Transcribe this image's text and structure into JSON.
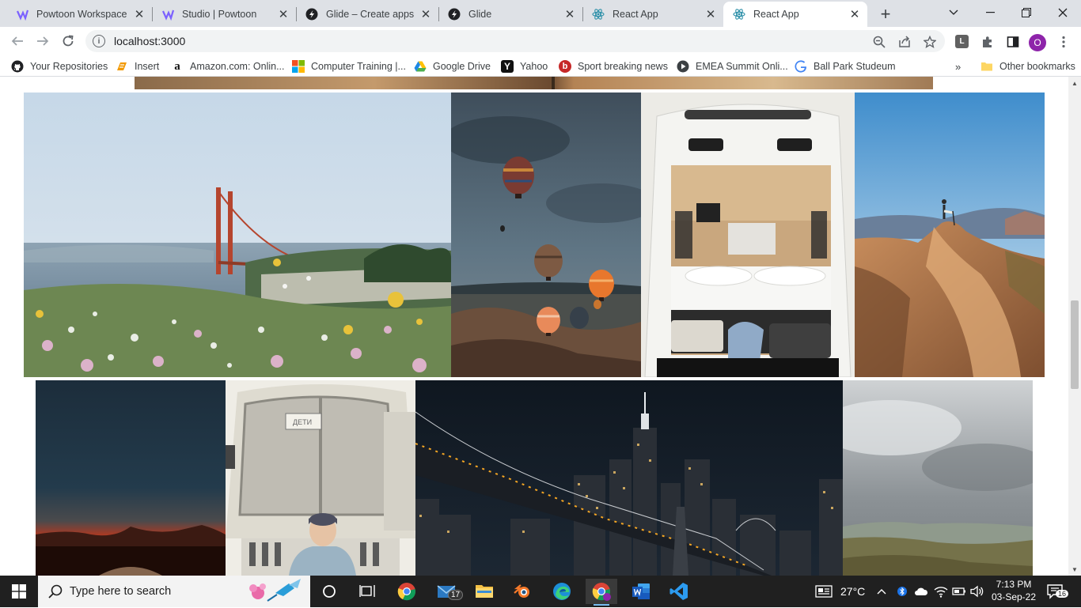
{
  "browser": {
    "tabs": [
      {
        "title": "Powtoon Workspace",
        "icon": "powtoon-icon",
        "active": false
      },
      {
        "title": "Studio | Powtoon",
        "icon": "powtoon-icon",
        "active": false
      },
      {
        "title": "Glide – Create apps &",
        "icon": "glide-icon",
        "active": false
      },
      {
        "title": "Glide",
        "icon": "glide-icon",
        "active": false
      },
      {
        "title": "React App",
        "icon": "react-icon",
        "active": false
      },
      {
        "title": "React App",
        "icon": "react-icon",
        "active": true
      }
    ],
    "url": "localhost:3000",
    "profile_initial": "O",
    "extension_initial": "L",
    "bookmarks": [
      {
        "label": "Your Repositories",
        "icon": "github-icon"
      },
      {
        "label": "Insert",
        "icon": "insert-icon"
      },
      {
        "label": "Amazon.com: Onlin...",
        "icon": "amazon-icon"
      },
      {
        "label": "Computer Training |...",
        "icon": "microsoft-icon"
      },
      {
        "label": "Google Drive",
        "icon": "google-drive-icon"
      },
      {
        "label": "Yahoo",
        "icon": "yahoo-icon"
      },
      {
        "label": "Sport breaking news",
        "icon": "sport-icon"
      },
      {
        "label": "EMEA Summit Onli...",
        "icon": "video-icon"
      },
      {
        "label": "Ball Park Studeum",
        "icon": "google-icon"
      }
    ],
    "other_bookmarks": "Other bookmarks"
  },
  "gallery": {
    "images": [
      {
        "subject": "golden-gate-bridge-flowers"
      },
      {
        "subject": "hot-air-balloons"
      },
      {
        "subject": "camper-van-interior"
      },
      {
        "subject": "hiker-desert-ridge"
      },
      {
        "subject": "sunset-dark-sky"
      },
      {
        "subject": "bus-child"
      },
      {
        "subject": "brooklyn-bridge-night"
      },
      {
        "subject": "cloudy-hills"
      }
    ]
  },
  "taskbar": {
    "search_placeholder": "Type here to search",
    "mail_badge": "17",
    "weather": "27°C",
    "time": "7:13 PM",
    "date": "03-Sep-22",
    "notification_count": "16"
  }
}
